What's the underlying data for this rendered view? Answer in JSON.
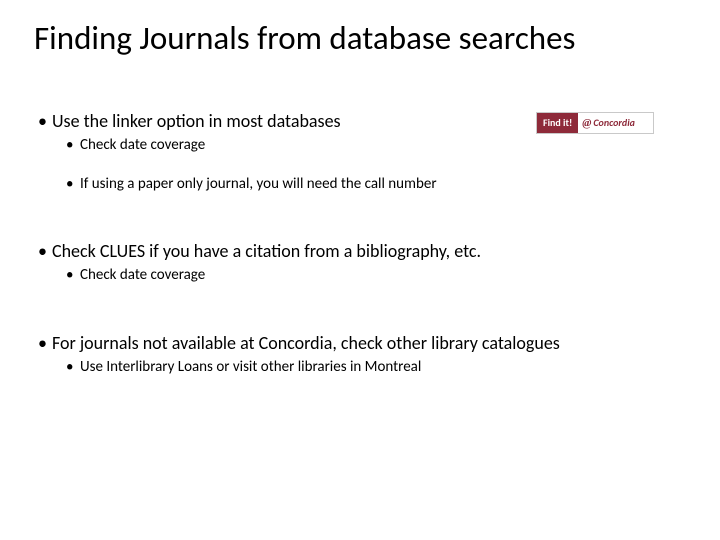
{
  "title": "Finding Journals from database searches",
  "bullets": {
    "b1": "Use the linker option in most databases",
    "b1a": "Check date coverage",
    "b1b": "If using a paper only journal, you will need the call number",
    "b2": "Check CLUES if you have a citation from a bibliography, etc.",
    "b2a": "Check date coverage",
    "b3": "For journals not available at Concordia, check other library catalogues",
    "b3a": "Use Interlibrary Loans or visit other libraries in Montreal"
  },
  "badge": {
    "left": "Find it!",
    "at": "@",
    "right": "Concordia"
  }
}
